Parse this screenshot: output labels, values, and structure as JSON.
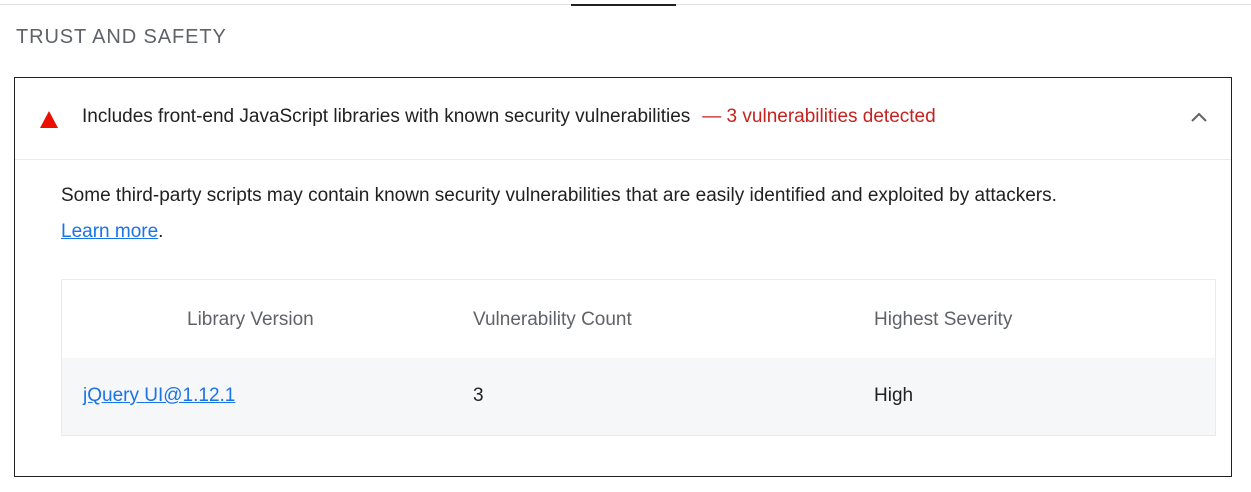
{
  "section": {
    "title": "TRUST AND SAFETY"
  },
  "audit": {
    "title": "Includes front-end JavaScript libraries with known security vulnerabilities",
    "display_value": "— 3 vulnerabilities detected",
    "status_icon": "fail-triangle-icon",
    "expand_icon": "chevron-up-icon",
    "description": "Some third-party scripts may contain known security vulnerabilities that are easily identified and exploited by attackers.",
    "learn_more": "Learn more",
    "learn_more_suffix": ".",
    "colors": {
      "fail": "#eb0f00",
      "display_value": "#c5221f",
      "link": "#1a73e8"
    }
  },
  "table": {
    "headers": [
      "Library Version",
      "Vulnerability Count",
      "Highest Severity"
    ],
    "rows": [
      {
        "library": "jQuery UI@1.12.1",
        "count": "3",
        "severity": "High"
      }
    ]
  }
}
